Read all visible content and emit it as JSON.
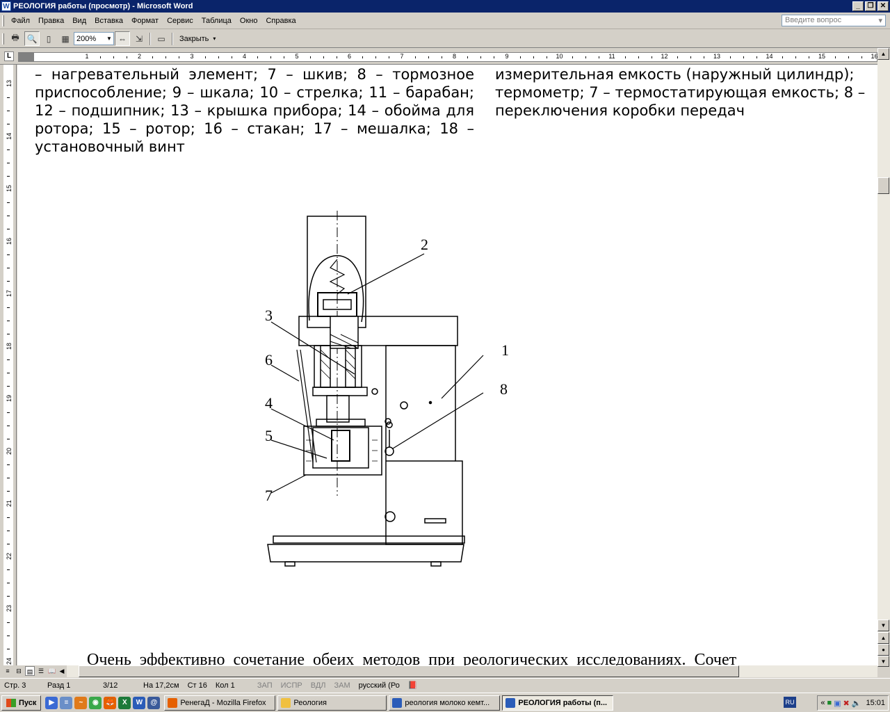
{
  "window": {
    "title": "РЕОЛОГИЯ работы (просмотр) - Microsoft Word",
    "app_icon": "W"
  },
  "menu": {
    "items": [
      "Файл",
      "Правка",
      "Вид",
      "Вставка",
      "Формат",
      "Сервис",
      "Таблица",
      "Окно",
      "Справка"
    ],
    "ask_placeholder": "Введите вопрос"
  },
  "toolbar": {
    "zoom": "200%",
    "close_label": "Закрыть"
  },
  "ruler": {
    "corner": "L",
    "numbers": [
      "1",
      "2",
      "3",
      "4",
      "5",
      "6",
      "7",
      "8",
      "9",
      "10",
      "11",
      "12",
      "13",
      "14",
      "15",
      "16"
    ],
    "vnumbers": [
      "13",
      "14",
      "15",
      "16",
      "17",
      "18",
      "19",
      "20",
      "21",
      "22",
      "23",
      "24"
    ]
  },
  "document": {
    "left_column": "– нагревательный элемент; 7 – шкив; 8 – тормозное приспособление; 9 – шкала; 10 – стрелка; 11 – барабан; 12 – подшипник; 13 – крышка прибора; 14 – обойма для ротора; 15 – ротор; 16 – стакан; 17 – мешалка; 18 – установочный винт",
    "right_column": "измерительная емкость (наружный цилиндр); термометр; 7 – термостатирующая емкость; 8 – переключения коробки передач",
    "bottom_text": "Очень эффективно сочетание обеих методов при реологических исследованиях. Сочет",
    "figure_labels": [
      "1",
      "2",
      "3",
      "4",
      "5",
      "6",
      "7",
      "8"
    ]
  },
  "status": {
    "page": "Стр. 3",
    "section": "Разд 1",
    "pages": "3/12",
    "at": "На 17,2см",
    "line": "Ст 16",
    "col": "Кол 1",
    "rec": "ЗАП",
    "trk": "ИСПР",
    "ext": "ВДЛ",
    "ovr": "ЗАМ",
    "language": "русский (Ро"
  },
  "taskbar": {
    "start": "Пуск",
    "tasks": [
      {
        "label": "РенегаД - Mozilla Firefox",
        "icon": "firefox-icon",
        "color": "#e66000"
      },
      {
        "label": "Реология",
        "icon": "folder-icon",
        "color": "#f0c040"
      },
      {
        "label": "реология молоко  кемт...",
        "icon": "word-doc-icon",
        "color": "#2b5cb8"
      },
      {
        "label": "РЕОЛОГИЯ работы (п...",
        "icon": "word-doc-icon",
        "color": "#2b5cb8"
      }
    ],
    "lang": "RU",
    "clock": "15:01"
  }
}
